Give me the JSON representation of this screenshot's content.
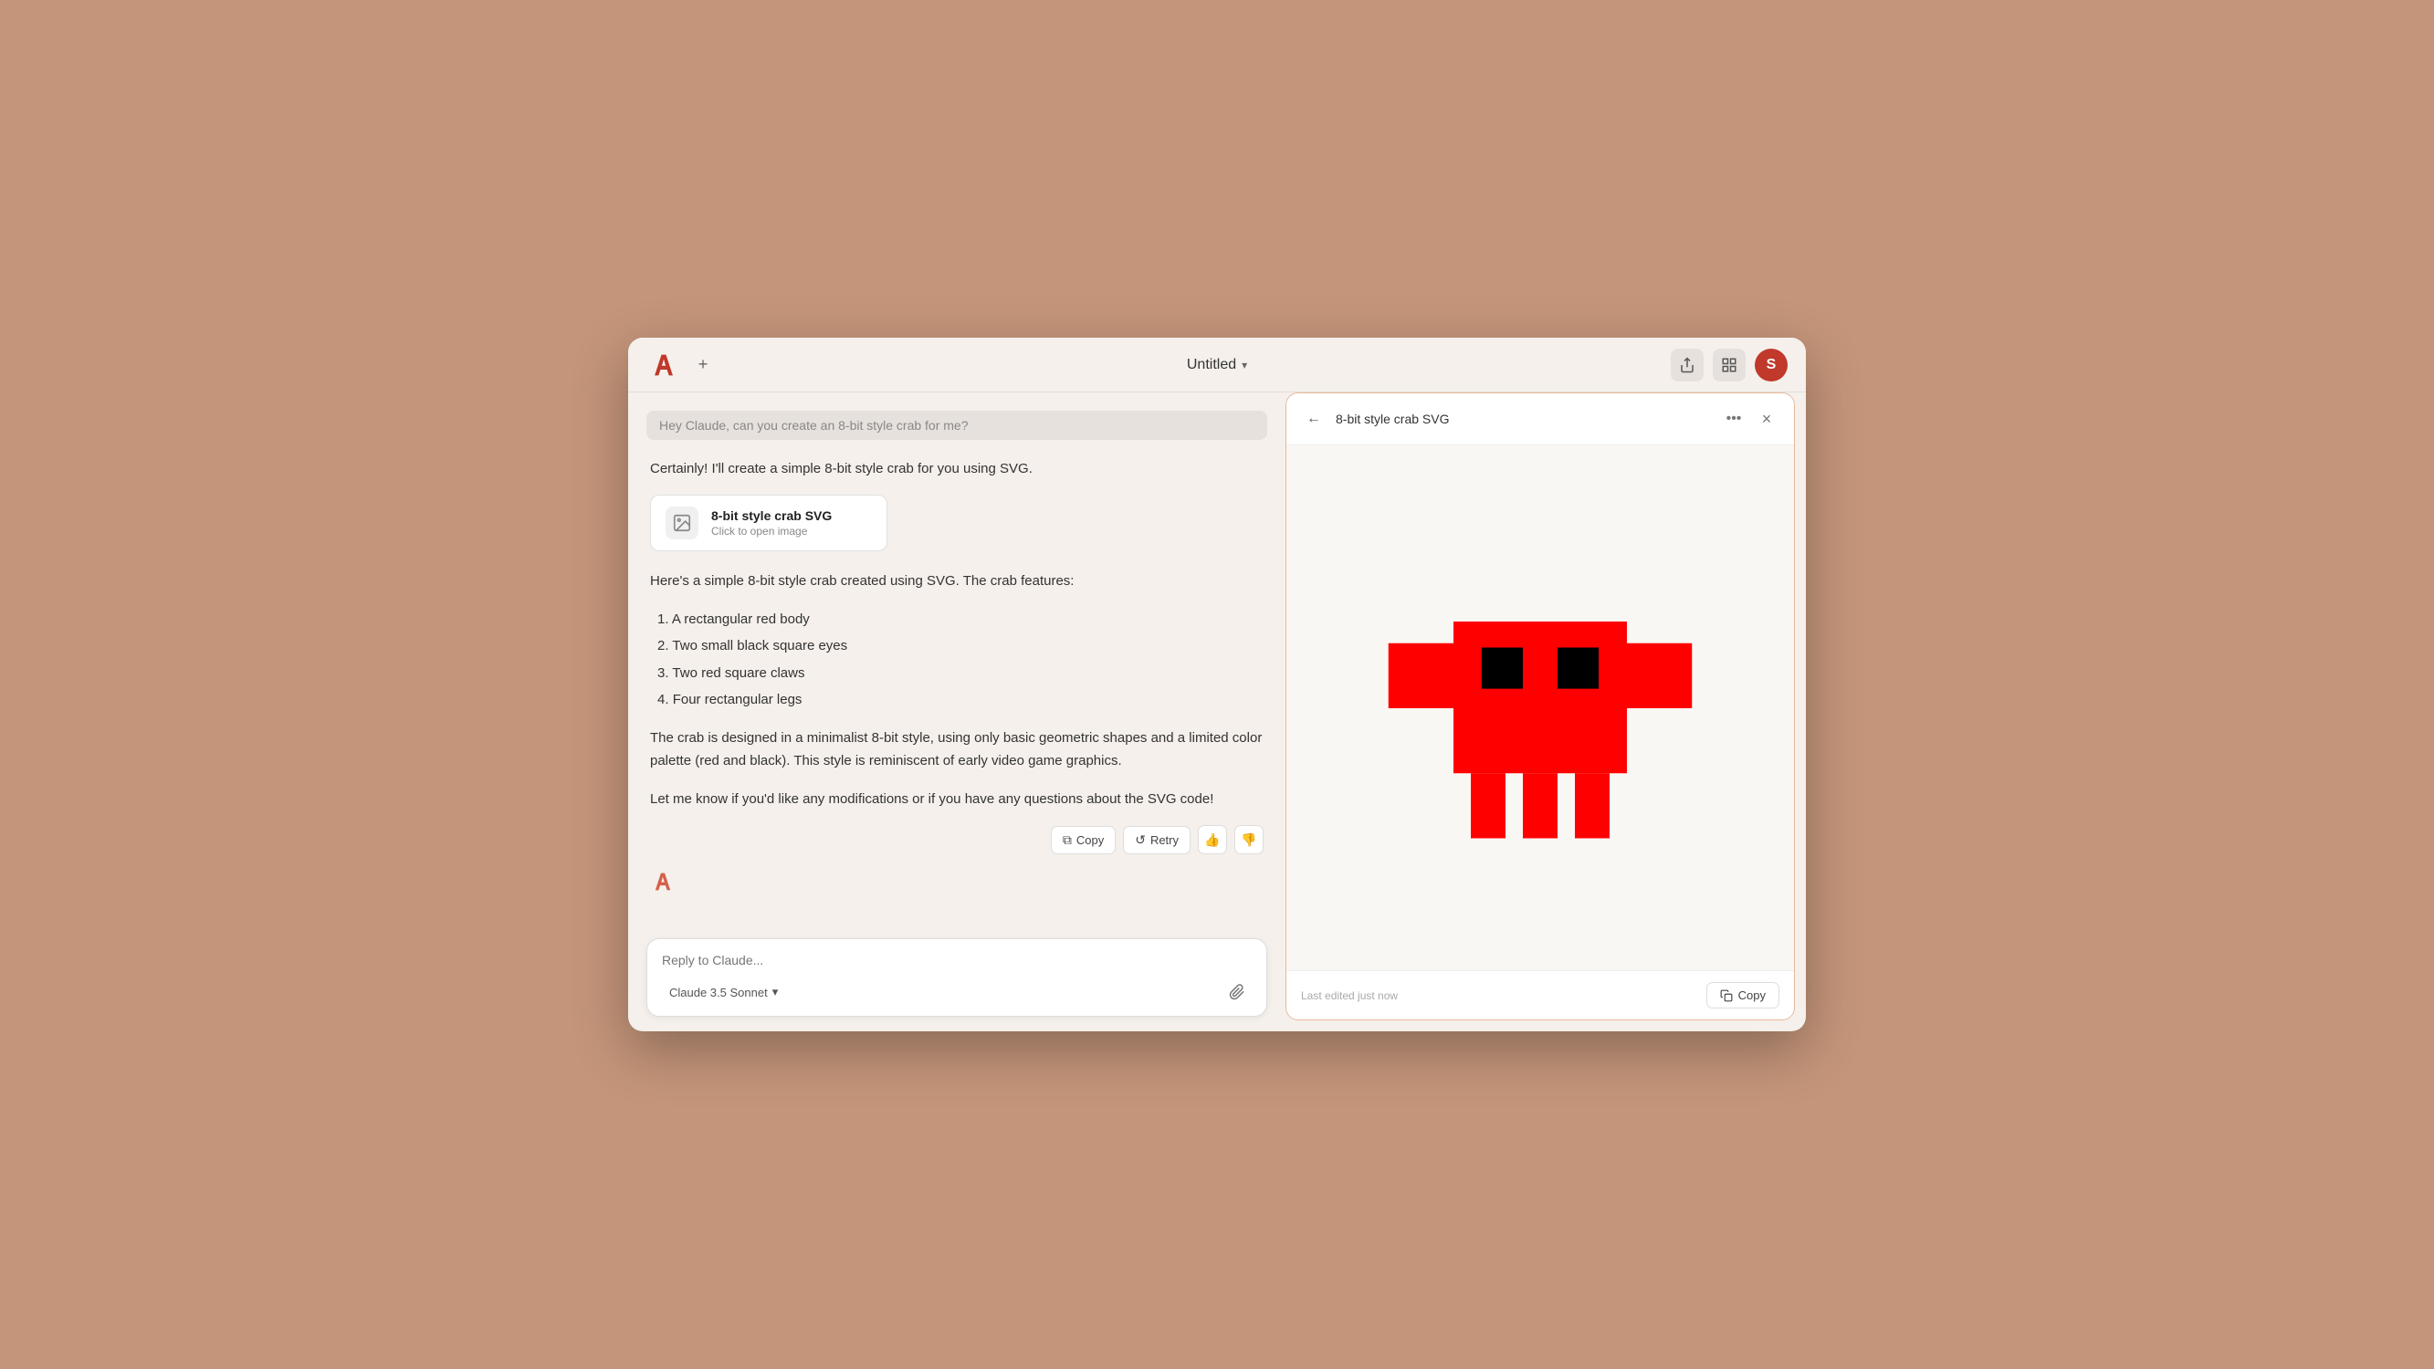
{
  "window": {
    "title": "Untitled",
    "title_chevron": "▾"
  },
  "header": {
    "logo_label": "Anthropic",
    "new_chat_label": "+",
    "share_icon": "share",
    "settings_icon": "settings",
    "avatar_letter": "S",
    "avatar_color": "#c0392b"
  },
  "chat": {
    "user_message_placeholder": "Hey Claude, can you create an 8-bit style crab for me?",
    "intro_text": "Certainly! I'll create a simple 8-bit style crab for you using SVG.",
    "artifact_card": {
      "title": "8-bit style crab SVG",
      "subtitle": "Click to open image"
    },
    "section_intro": "Here's a simple 8-bit style crab created using SVG. The crab features:",
    "features": [
      {
        "num": "1",
        "text": "A rectangular red body"
      },
      {
        "num": "2",
        "text": "Two small black square eyes"
      },
      {
        "num": "3",
        "text": "Two red square claws"
      },
      {
        "num": "4",
        "text": "Four rectangular legs"
      }
    ],
    "body1": "The crab is designed in a minimalist 8-bit style, using only basic geometric shapes and a limited color palette (red and black). This style is reminiscent of early video game graphics.",
    "body2": "Let me know if you'd like any modifications or if you have any questions about the SVG code!",
    "actions": {
      "copy_label": "Copy",
      "retry_label": "Retry",
      "thumbs_up": "👍",
      "thumbs_down": "👎"
    },
    "input_placeholder": "Reply to Claude...",
    "model_name": "Claude 3.5 Sonnet",
    "model_chevron": "▾"
  },
  "artifact": {
    "title": "8-bit style crab SVG",
    "last_edited": "Last edited just now",
    "copy_label": "Copy",
    "crab_color": "#ff0000",
    "eye_color": "#000000"
  },
  "icons": {
    "back": "←",
    "more": "•••",
    "close": "×",
    "copy_symbol": "⧉",
    "retry_symbol": "↺",
    "attach": "📎",
    "share": "↑",
    "settings": "⊞"
  }
}
